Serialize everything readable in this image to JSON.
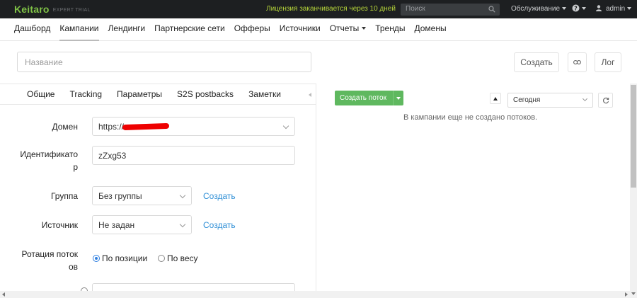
{
  "topbar": {
    "logo": "Keitaro",
    "edition": "EXPERT TRIAL",
    "license_notice": "Лицензия заканчивается через 10 дней",
    "search_placeholder": "Поиск",
    "service_menu": "Обслуживание",
    "help_icon": "?",
    "user": "admin",
    "colors": {
      "bg": "#1d1f21",
      "logo": "#7fc146",
      "license": "#b5d43a"
    }
  },
  "nav": {
    "items": [
      {
        "label": "Дашборд"
      },
      {
        "label": "Кампании",
        "active": true
      },
      {
        "label": "Лендинги"
      },
      {
        "label": "Партнерские сети"
      },
      {
        "label": "Офферы"
      },
      {
        "label": "Источники"
      },
      {
        "label": "Отчеты",
        "dropdown": true
      },
      {
        "label": "Тренды"
      },
      {
        "label": "Домены"
      }
    ]
  },
  "campaign": {
    "name_placeholder": "Название",
    "create_button": "Создать",
    "link_icon": "link-icon",
    "log_button": "Лог"
  },
  "tabs": {
    "items": [
      "Общие",
      "Tracking",
      "Параметры",
      "S2S postbacks",
      "Заметки"
    ]
  },
  "form": {
    "domain_label": "Домен",
    "domain_value": "https://",
    "identifier_label": "Идентификато\nр",
    "identifier_label_line1": "Идентификато",
    "identifier_label_line2": "р",
    "identifier_value": "zZxg53",
    "group_label": "Группа",
    "group_value": "Без группы",
    "group_create": "Создать",
    "source_label": "Источник",
    "source_value": "Не задан",
    "source_create": "Создать",
    "rotation_label_line1": "Ротация поток",
    "rotation_label_line2": "ов",
    "rotation_options": [
      {
        "label": "По позиции",
        "selected": true
      },
      {
        "label": "По весу",
        "selected": false
      }
    ]
  },
  "streams": {
    "create_button": "Создать поток",
    "period": "Сегодня",
    "empty_message": "В кампании еще не создано потоков.",
    "colors": {
      "create": "#5fb85f"
    }
  }
}
